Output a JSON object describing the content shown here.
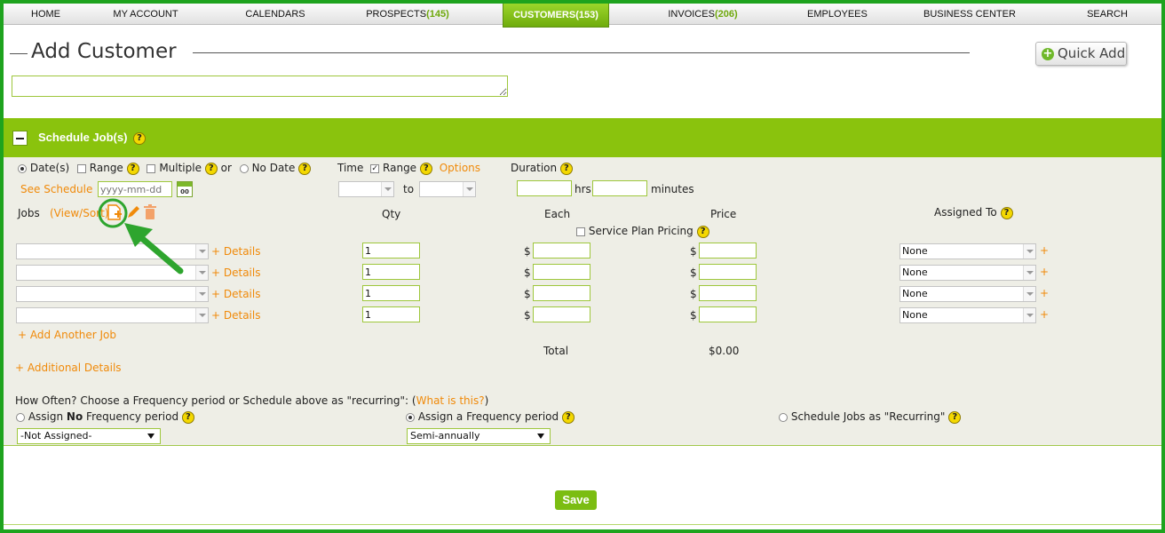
{
  "nav": {
    "items": [
      {
        "label": "HOME",
        "count": ""
      },
      {
        "label": "MY ACCOUNT",
        "count": ""
      },
      {
        "label": "CALENDARS",
        "count": ""
      },
      {
        "label": "PROSPECTS",
        "count": "(145)"
      },
      {
        "label": "CUSTOMERS",
        "count": "(153)"
      },
      {
        "label": "INVOICES",
        "count": "(206)"
      },
      {
        "label": "EMPLOYEES",
        "count": ""
      },
      {
        "label": "BUSINESS CENTER",
        "count": ""
      },
      {
        "label": "SEARCH",
        "count": ""
      }
    ],
    "active": "CUSTOMERS"
  },
  "header": {
    "title": "Add Customer",
    "quick_add": "Quick Add"
  },
  "schedule": {
    "title": "Schedule Job(s)",
    "date_options": {
      "dates": "Date(s)",
      "range": "Range",
      "multiple": "Multiple",
      "or": "or",
      "no_date": "No Date"
    },
    "see_schedule": "See Schedule",
    "date_placeholder": "yyyy-mm-dd",
    "calendar_icon_text": "00",
    "time_label": "Time",
    "time_range": "Range",
    "options_link": "Options",
    "to_label": "to",
    "duration_label": "Duration",
    "hrs_label": "hrs",
    "minutes_label": "minutes",
    "jobs_label": "Jobs",
    "view_sort": "(View/Sort)",
    "columns": {
      "qty": "Qty",
      "each": "Each",
      "price": "Price",
      "assigned_to": "Assigned To"
    },
    "service_plan_pricing": "Service Plan Pricing",
    "rows": [
      {
        "details": "+ Details",
        "qty": "1",
        "currency": "$",
        "assigned": "None",
        "plus": "+"
      },
      {
        "details": "+ Details",
        "qty": "1",
        "currency": "$",
        "assigned": "None",
        "plus": "+"
      },
      {
        "details": "+ Details",
        "qty": "1",
        "currency": "$",
        "assigned": "None",
        "plus": "+"
      },
      {
        "details": "+ Details",
        "qty": "1",
        "currency": "$",
        "assigned": "None",
        "plus": "+"
      }
    ],
    "add_another_job": "+ Add Another Job",
    "total_label": "Total",
    "total_value": "$0.00",
    "additional_details": "+ Additional Details",
    "how_often_prefix": "How Often? Choose a Frequency period or Schedule above as \"recurring\": (",
    "what_is_this": "What is this?",
    "how_often_suffix": ")",
    "freq": {
      "assign_no_prefix": "Assign ",
      "assign_no_bold": "No",
      "assign_no_suffix": " Frequency period",
      "not_assigned": "-Not Assigned-",
      "assign_freq": "Assign a Frequency period",
      "semi_annually": "Semi-annually",
      "schedule_recurring": "Schedule Jobs as \"Recurring\""
    },
    "help_glyph": "?"
  },
  "save": "Save",
  "colors": {
    "frame": "#1ea31e",
    "brand_green": "#8ac30d",
    "accent_orange": "#f08a0a",
    "annotation_green": "#2ea52e"
  }
}
